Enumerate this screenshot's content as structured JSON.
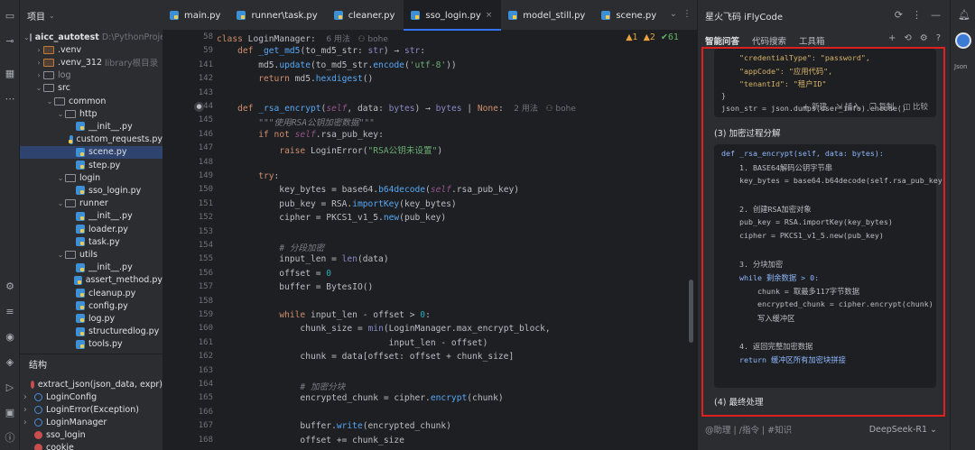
{
  "project": {
    "header_label": "项目",
    "tree": [
      {
        "name": "aicc_autotest",
        "suffix": "D:\\PythonProje",
        "kind": "folder",
        "depth": 0,
        "open": true,
        "bold": true
      },
      {
        "name": ".venv",
        "suffix": "",
        "kind": "folder-ex",
        "depth": 1,
        "open": false
      },
      {
        "name": ".venv_312",
        "suffix": "library根目录",
        "kind": "folder-ex",
        "depth": 1,
        "open": false
      },
      {
        "name": "log",
        "suffix": "",
        "kind": "folder",
        "depth": 1,
        "open": false,
        "muted": true
      },
      {
        "name": "src",
        "suffix": "",
        "kind": "folder",
        "depth": 1,
        "open": true
      },
      {
        "name": "common",
        "suffix": "",
        "kind": "folder",
        "depth": 2,
        "open": true
      },
      {
        "name": "http",
        "suffix": "",
        "kind": "folder",
        "depth": 3,
        "open": true
      },
      {
        "name": "__init__.py",
        "suffix": "",
        "kind": "py",
        "depth": 4
      },
      {
        "name": "custom_requests.py",
        "suffix": "",
        "kind": "py",
        "depth": 4
      },
      {
        "name": "scene.py",
        "suffix": "",
        "kind": "py",
        "depth": 4,
        "selected": true
      },
      {
        "name": "step.py",
        "suffix": "",
        "kind": "py",
        "depth": 4
      },
      {
        "name": "login",
        "suffix": "",
        "kind": "folder",
        "depth": 3,
        "open": true
      },
      {
        "name": "sso_login.py",
        "suffix": "",
        "kind": "py",
        "depth": 4
      },
      {
        "name": "runner",
        "suffix": "",
        "kind": "folder",
        "depth": 3,
        "open": true
      },
      {
        "name": "__init__.py",
        "suffix": "",
        "kind": "py",
        "depth": 4
      },
      {
        "name": "loader.py",
        "suffix": "",
        "kind": "py",
        "depth": 4
      },
      {
        "name": "task.py",
        "suffix": "",
        "kind": "py",
        "depth": 4
      },
      {
        "name": "utils",
        "suffix": "",
        "kind": "folder",
        "depth": 3,
        "open": true
      },
      {
        "name": "__init__.py",
        "suffix": "",
        "kind": "py",
        "depth": 4
      },
      {
        "name": "assert_method.py",
        "suffix": "",
        "kind": "py",
        "depth": 4
      },
      {
        "name": "cleanup.py",
        "suffix": "",
        "kind": "py",
        "depth": 4
      },
      {
        "name": "config.py",
        "suffix": "",
        "kind": "py",
        "depth": 4
      },
      {
        "name": "log.py",
        "suffix": "",
        "kind": "py",
        "depth": 4
      },
      {
        "name": "structuredlog.py",
        "suffix": "",
        "kind": "py",
        "depth": 4
      },
      {
        "name": "tools.py",
        "suffix": "",
        "kind": "py",
        "depth": 4
      }
    ]
  },
  "structure": {
    "title": "结构",
    "items": [
      {
        "name": "extract_json(json_data, expr)",
        "kind": "f",
        "arrow": false
      },
      {
        "name": "LoginConfig",
        "kind": "c",
        "arrow": true
      },
      {
        "name": "LoginError(Exception)",
        "kind": "c",
        "arrow": true
      },
      {
        "name": "LoginManager",
        "kind": "c",
        "arrow": true
      },
      {
        "name": "sso_login",
        "kind": "f",
        "arrow": false
      },
      {
        "name": "cookie",
        "kind": "f",
        "arrow": false
      }
    ]
  },
  "editor": {
    "tabs": [
      {
        "label": "main.py",
        "active": false
      },
      {
        "label": "runner\\task.py",
        "active": false
      },
      {
        "label": "cleaner.py",
        "active": false
      },
      {
        "label": "sso_login.py",
        "active": true
      },
      {
        "label": "model_still.py",
        "active": false
      },
      {
        "label": "scene.py",
        "active": false
      }
    ],
    "inspections": {
      "warn": "▲1",
      "weak": "▲2",
      "ok": "✔61"
    },
    "line_numbers": [
      "58",
      "59",
      "141",
      "142",
      "143",
      "144",
      "145",
      "146",
      "147",
      "148",
      "149",
      "150",
      "151",
      "152",
      "153",
      "154",
      "155",
      "156",
      "157",
      "158",
      "159",
      "160",
      "161",
      "162",
      "163",
      "164",
      "165",
      "166",
      "167",
      "168"
    ],
    "lines": [
      "<span class='kw'>class</span> LoginManager:  <span class='hint'>6 用法   ⚇ bohe</span>",
      "    <span class='kw'>def</span> <span class='fn'>_get_md5</span>(to_md5_str: <span class='bi'>str</span>) → <span class='bi'>str</span>:",
      "        md5.<span class='fn'>update</span>(to_md5_str.<span class='fn'>encode</span>(<span class='st'>'utf-8'</span>))",
      "        <span class='kw'>return</span> md5.<span class='fn'>hexdigest</span>()",
      "",
      "    <span class='kw'>def</span> <span class='fn'>_rsa_encrypt</span>(<span class='sf'>self</span>, data: <span class='bi'>bytes</span>) → <span class='bi'>bytes</span> | <span class='kw'>None</span>:  <span class='hint'>2 用法   ⚇ bohe</span>",
      "        <span class='cm'>\"\"\"使用RSA公钥加密数据\"\"\"</span>",
      "        <span class='kw'>if not</span> <span class='sf'>self</span>.rsa_pub_key:",
      "            <span class='kw'>raise</span> LoginError(<span class='st'>\"RSA公钥未设置\"</span>)",
      "",
      "        <span class='kw'>try</span>:",
      "            key_bytes = base64.<span class='fn'>b64decode</span>(<span class='sf'>self</span>.rsa_pub_key)",
      "            pub_key = RSA.<span class='fn'>importKey</span>(key_bytes)",
      "            cipher = PKCS1_v1_5.<span class='fn'>new</span>(pub_key)",
      "",
      "            <span class='cm'># 分段加密</span>",
      "            input_len = <span class='bi'>len</span>(data)",
      "            offset = <span class='nm'>0</span>",
      "            buffer = BytesIO()",
      "",
      "            <span class='kw'>while</span> input_len - offset > <span class='nm'>0</span>:",
      "                chunk_size = <span class='bi'>min</span>(LoginManager.max_encrypt_block,",
      "                                 input_len - offset)",
      "                chunk = data[offset: offset + chunk_size]",
      "",
      "                <span class='cm'># 加密分块</span>",
      "                encrypted_chunk = cipher.<span class='fn'>encrypt</span>(chunk)",
      "",
      "                buffer.<span class='fn'>write</span>(encrypted_chunk)",
      "                offset += chunk_size"
    ]
  },
  "ai": {
    "title": "星火飞码 iFlyCode",
    "tabs": [
      "智能问答",
      "代码搜索",
      "工具箱"
    ],
    "code_block_1": [
      "    \"credentialType\": \"password\",",
      "    \"appCode\": \"应用代码\",",
      "    \"tenantId\": \"租户ID\"",
      "}",
      "json_str = json.dumps(user_info).encode()"
    ],
    "section_3": "(3) 加密过程分解",
    "code_actions": [
      "+ 新建",
      "⇲ 插入",
      "❐ 复制",
      "◫ 比较"
    ],
    "code_block_2": [
      "def _rsa_encrypt(self, data: bytes):",
      "    1. BASE64解码公钥字节串",
      "    key_bytes = base64.b64decode(self.rsa_pub_key)",
      "",
      "    2. 创建RSA加密对象",
      "    pub_key = RSA.importKey(key_bytes)",
      "    cipher = PKCS1_v1_5.new(pub_key)",
      "",
      "    3. 分块加密",
      "    while 剩余数据 > 0:",
      "        chunk = 取最多117字节数据",
      "        encrypted_chunk = cipher.encrypt(chunk)",
      "        写入缓冲区",
      "",
      "    4. 返回完整加密数据",
      "    return 缓冲区所有加密块拼接"
    ],
    "section_4": "(4) 最终处理",
    "input_placeholder": "@助理  | /指令  | #知识",
    "model": "DeepSeek-R1 ⌄"
  },
  "right_strip": {
    "json_label": "Json"
  }
}
